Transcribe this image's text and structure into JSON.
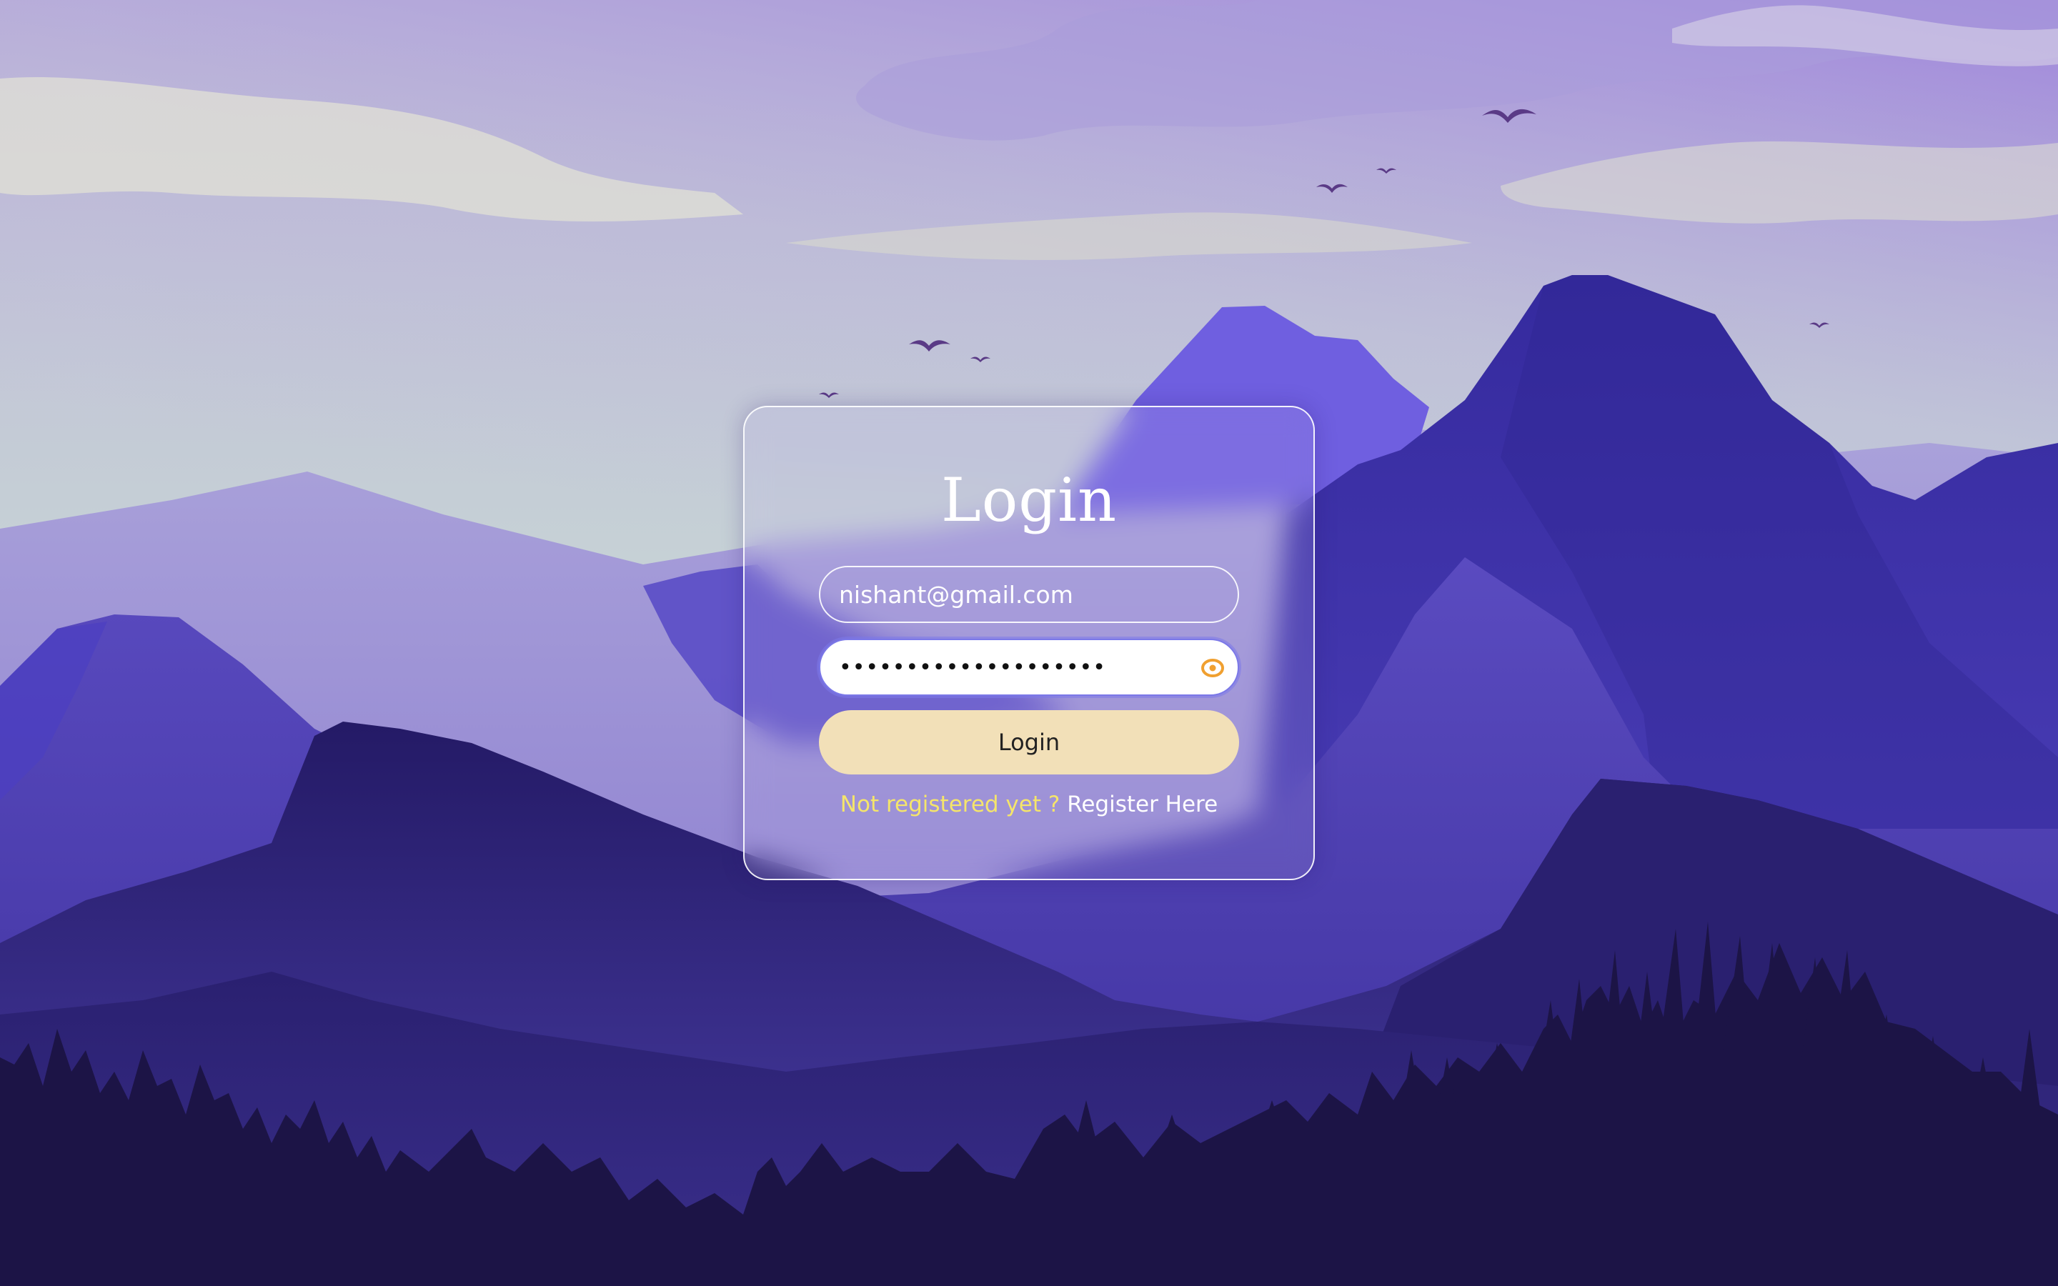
{
  "login": {
    "title": "Login",
    "email_value": "nishant@gmail.com",
    "password_mask": "••••••••••••••••••••",
    "button_label": "Login",
    "prompt_text": "Not registered yet ?",
    "register_link": "Register Here"
  },
  "colors": {
    "button_bg": "#f2e0b8",
    "prompt_yellow": "#f5e56a",
    "eye_icon": "#f0a030",
    "focus_ring": "#7b78e8"
  },
  "icons": {
    "password_toggle": "eye-icon"
  }
}
